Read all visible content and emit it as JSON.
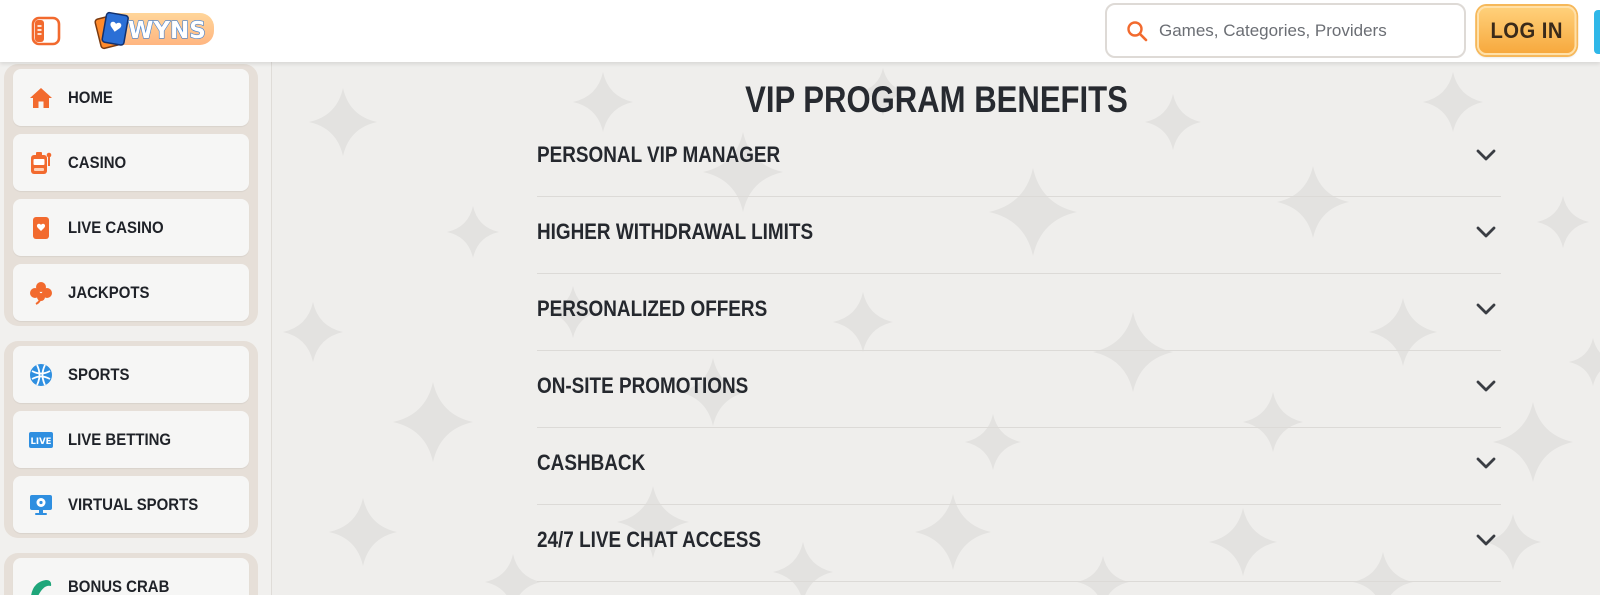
{
  "header": {
    "logo_text": "WYNS",
    "search": {
      "placeholder": "Games, Categories, Providers",
      "value": ""
    },
    "login_label": "LOG IN"
  },
  "sidebar": {
    "groups": [
      {
        "items": [
          {
            "label": "HOME",
            "icon": "home-icon"
          },
          {
            "label": "CASINO",
            "icon": "slot-machine-icon"
          },
          {
            "label": "LIVE CASINO",
            "icon": "playing-card-icon"
          },
          {
            "label": "JACKPOTS",
            "icon": "clover-icon"
          }
        ]
      },
      {
        "items": [
          {
            "label": "SPORTS",
            "icon": "sports-ball-icon"
          },
          {
            "label": "LIVE BETTING",
            "icon": "live-badge-icon",
            "badge_text": "LIVE"
          },
          {
            "label": "VIRTUAL SPORTS",
            "icon": "virtual-sports-monitor-icon"
          }
        ]
      },
      {
        "items": [
          {
            "label": "BONUS CRAB",
            "icon": "bonus-crab-icon"
          }
        ]
      }
    ]
  },
  "main": {
    "title": "VIP PROGRAM BENEFITS",
    "benefits": [
      "PERSONAL VIP MANAGER",
      "HIGHER WITHDRAWAL LIMITS",
      "PERSONALIZED OFFERS",
      "ON-SITE PROMOTIONS",
      "CASHBACK",
      "24/7 LIVE CHAT ACCESS"
    ]
  },
  "colors": {
    "accent_orange": "#f26a2e",
    "login_button": "#f7a93e",
    "page_background": "#efeeec",
    "sidebar_group": "#e6dfd8",
    "text_dark": "#25282e"
  }
}
